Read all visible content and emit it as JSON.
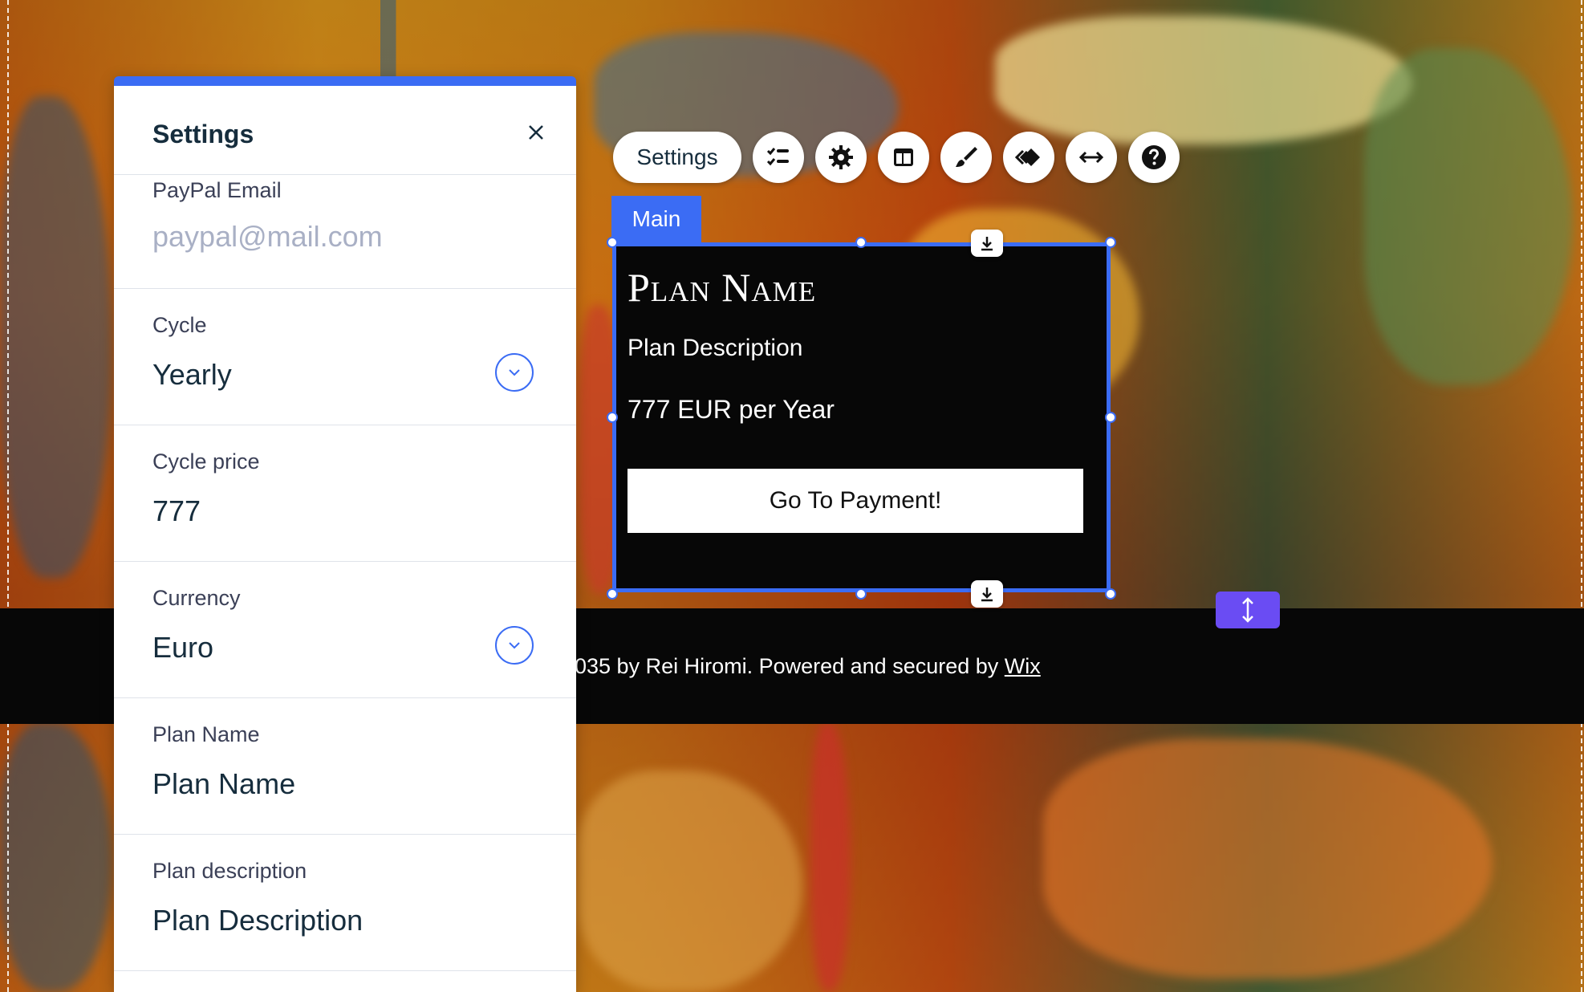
{
  "colors": {
    "accent": "#3b6cf4",
    "stretch_handle": "#6a4cf3",
    "widget_background": "#070707",
    "footer_background": "#070707"
  },
  "settings_panel": {
    "title": "Settings",
    "close_icon": "close-icon",
    "fields": [
      {
        "label": "PayPal Email",
        "placeholder": "paypal@mail.com"
      },
      {
        "label": "Cycle",
        "value": "Yearly",
        "type": "dropdown"
      },
      {
        "label": "Cycle price",
        "value": "777"
      },
      {
        "label": "Currency",
        "value": "Euro",
        "type": "dropdown"
      },
      {
        "label": "Plan Name",
        "value": "Plan Name"
      },
      {
        "label": "Plan description",
        "value": "Plan Description"
      }
    ]
  },
  "toolbar": {
    "settings_label": "Settings",
    "icons": [
      "checklist-icon",
      "gear-icon",
      "layout-icon",
      "brush-icon",
      "animation-icon",
      "stretch-icon",
      "help-icon"
    ]
  },
  "section_tag": "Main",
  "widget": {
    "plan_name": "Plan Name",
    "plan_description": "Plan Description",
    "price_line": "777 EUR per Year",
    "button_label": "Go To Payment!"
  },
  "footer": {
    "text": "035 by Rei Hiromi. Powered and secured by ",
    "link_text": "Wix"
  }
}
